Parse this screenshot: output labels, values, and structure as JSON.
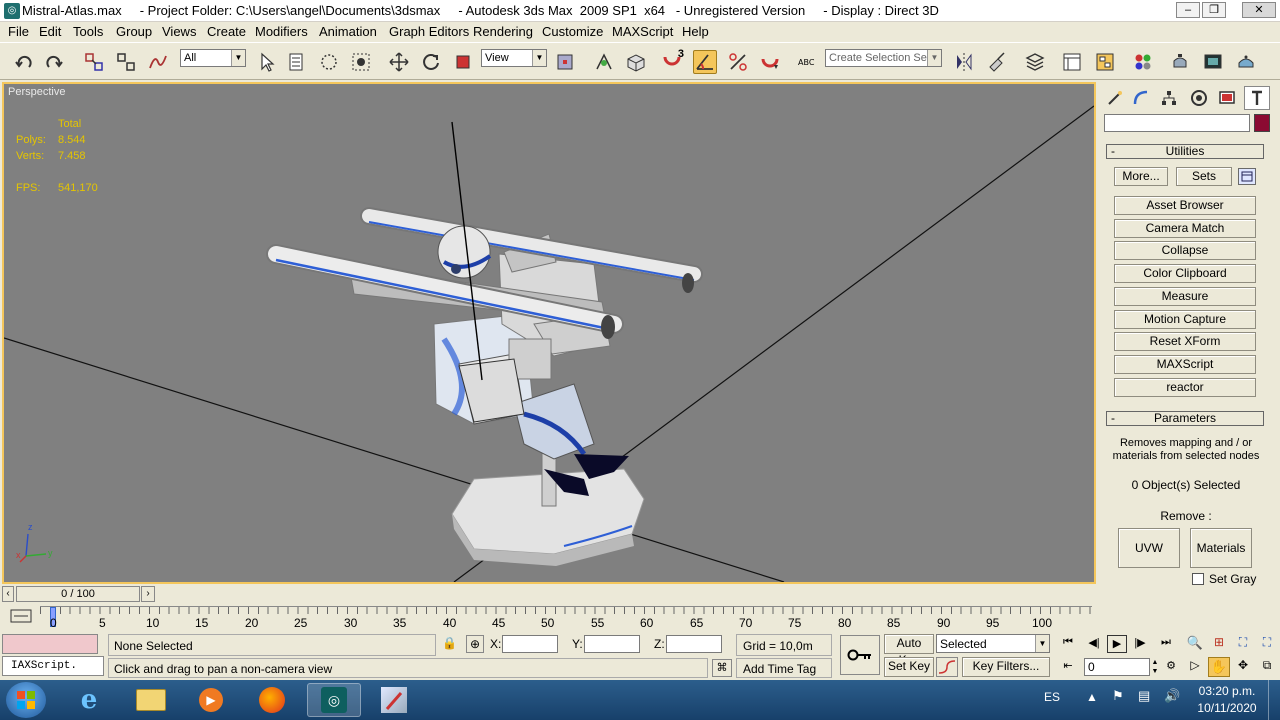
{
  "window": {
    "title": "Mistral-Atlas.max     - Project Folder: C:\\Users\\angel\\Documents\\3dsmax     - Autodesk 3ds Max  2009 SP1  x64   - Unregistered Version     - Display : Direct 3D",
    "controls": [
      "minimize",
      "maximize",
      "close"
    ]
  },
  "menu": [
    "File",
    "Edit",
    "Tools",
    "Group",
    "Views",
    "Create",
    "Modifiers",
    "Animation",
    "Graph Editors",
    "Rendering",
    "Customize",
    "MAXScript",
    "Help"
  ],
  "toolbar": {
    "filter_value": "All",
    "refcoord_value": "View",
    "selection_set_placeholder": "Create Selection Set",
    "snap_badge": "3"
  },
  "viewport": {
    "label": "Perspective",
    "stats_header": "Total",
    "polys_label": "Polys:",
    "polys_value": "8.544",
    "verts_label": "Verts:",
    "verts_value": "7.458",
    "fps_label": "FPS:",
    "fps_value": "541,170",
    "axis_labels": {
      "z": "z",
      "x": "x",
      "y": "y"
    }
  },
  "command_panel": {
    "utilities_title": "Utilities",
    "more_label": "More...",
    "sets_label": "Sets",
    "utilities": [
      "Asset Browser",
      "Camera Match",
      "Collapse",
      "Color Clipboard",
      "Measure",
      "Motion Capture",
      "Reset XForm",
      "MAXScript",
      "reactor"
    ],
    "parameters_title": "Parameters",
    "description": "Removes mapping and / or materials from selected nodes",
    "selected_count": "0 Object(s) Selected",
    "remove_label": "Remove :",
    "uvw_label": "UVW",
    "materials_label": "Materials",
    "set_gray_label": "Set Gray",
    "color_swatch": "#8b0a32"
  },
  "timeline": {
    "frame_display": "0 / 100",
    "ticks": [
      "0",
      "5",
      "10",
      "15",
      "20",
      "25",
      "30",
      "35",
      "40",
      "45",
      "50",
      "55",
      "60",
      "65",
      "70",
      "75",
      "80",
      "85",
      "90",
      "95",
      "100"
    ]
  },
  "status": {
    "maxscript_listener": "IAXScript.",
    "selection": "None Selected",
    "prompt": "Click and drag to pan a non-camera view",
    "x_label": "X:",
    "y_label": "Y:",
    "z_label": "Z:",
    "grid": "Grid = 10,0m",
    "add_time_tag": "Add Time Tag",
    "auto_key": "Auto Key",
    "set_key": "Set Key",
    "key_mode": "Selected",
    "key_filters": "Key Filters...",
    "current_frame": "0"
  },
  "taskbar": {
    "language": "ES",
    "time": "03:20 p.m.",
    "date": "10/11/2020"
  },
  "colors": {
    "viewport_bg": "#808080",
    "active_border": "#f4c65b",
    "stats_yellow": "#e5c500",
    "model_blue": "#2e5fd6"
  }
}
